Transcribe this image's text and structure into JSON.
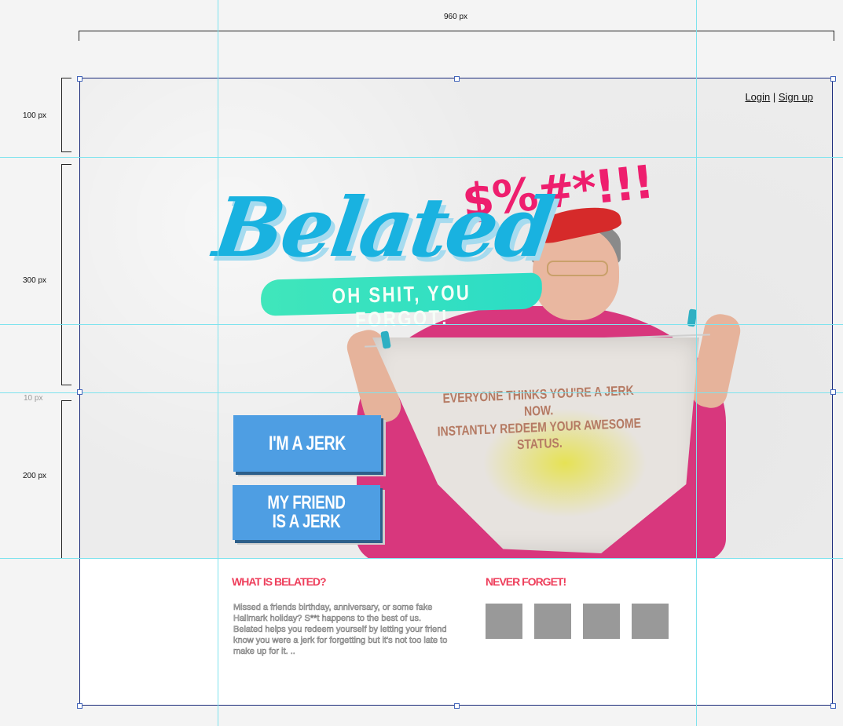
{
  "annotations": {
    "width_label": "960 px",
    "header_height_label": "100 px",
    "hero_height_label": "300 px",
    "gap_label": "10 px",
    "cta_height_label": "200 px"
  },
  "header": {
    "login_label": "Login",
    "separator": "|",
    "signup_label": "Sign up"
  },
  "logo": {
    "wordmark": "Belated",
    "expletive": "$%#*!!!",
    "tagline": "OH SHIT, YOU FORGOT!"
  },
  "hero": {
    "message_line1": "EVERYONE THINKS YOU'RE A JERK NOW.",
    "message_line2": "INSTANTLY REDEEM YOUR AWESOME STATUS."
  },
  "buttons": {
    "im_a_jerk": "I'M A JERK",
    "friend_line1": "MY FRIEND",
    "friend_line2": "IS A JERK"
  },
  "about": {
    "title": "WHAT IS BELATED?",
    "body": "Missed a friends birthday, anniversary, or some fake Hallmark holiday? S**t happens to the best of us.  Belated helps you redeem yourself by letting your friend know you were a jerk for forgetting but it's not too late to make up for it. .."
  },
  "never_forget": {
    "title": "NEVER FORGET!"
  },
  "colors": {
    "brand_blue": "#19b2e0",
    "tagline_green": "#40e6bb",
    "expletive_pink": "#ee1e6e",
    "button_blue": "#4e9ee3",
    "footer_title_red": "#ee3e5b"
  }
}
